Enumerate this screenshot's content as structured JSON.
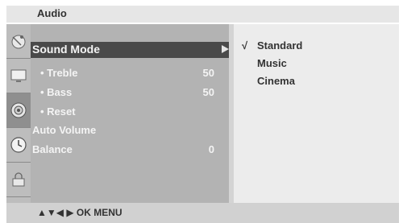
{
  "header": {
    "title": "Audio"
  },
  "sidebar": {
    "icons": [
      {
        "name": "satellite-dish-icon",
        "selected": false
      },
      {
        "name": "picture-icon",
        "selected": false
      },
      {
        "name": "speaker-icon",
        "selected": true
      },
      {
        "name": "clock-icon",
        "selected": false
      },
      {
        "name": "lock-icon",
        "selected": false
      }
    ]
  },
  "menu": {
    "items": [
      {
        "label": "Sound Mode",
        "value": "",
        "active": true,
        "sub": false
      },
      {
        "label": "• Treble",
        "value": "50",
        "active": false,
        "sub": true
      },
      {
        "label": "• Bass",
        "value": "50",
        "active": false,
        "sub": true
      },
      {
        "label": "• Reset",
        "value": "",
        "active": false,
        "sub": true
      },
      {
        "label": "Auto Volume",
        "value": "",
        "active": false,
        "sub": false
      },
      {
        "label": "Balance",
        "value": "0",
        "active": false,
        "sub": false
      }
    ]
  },
  "submenu": {
    "options": [
      {
        "label": "Standard",
        "checked": true,
        "check_mark": "√"
      },
      {
        "label": "Music",
        "checked": false,
        "check_mark": ""
      },
      {
        "label": "Cinema",
        "checked": false,
        "check_mark": ""
      }
    ]
  },
  "footer": {
    "nav_hint": "▲▼◀ ▶  OK  MENU"
  },
  "colors": {
    "highlight": "#4a4a4a",
    "menu_bg": "#b3b3b3",
    "submenu_bg": "#ececec",
    "icon_selected": "#8f8f8f"
  }
}
